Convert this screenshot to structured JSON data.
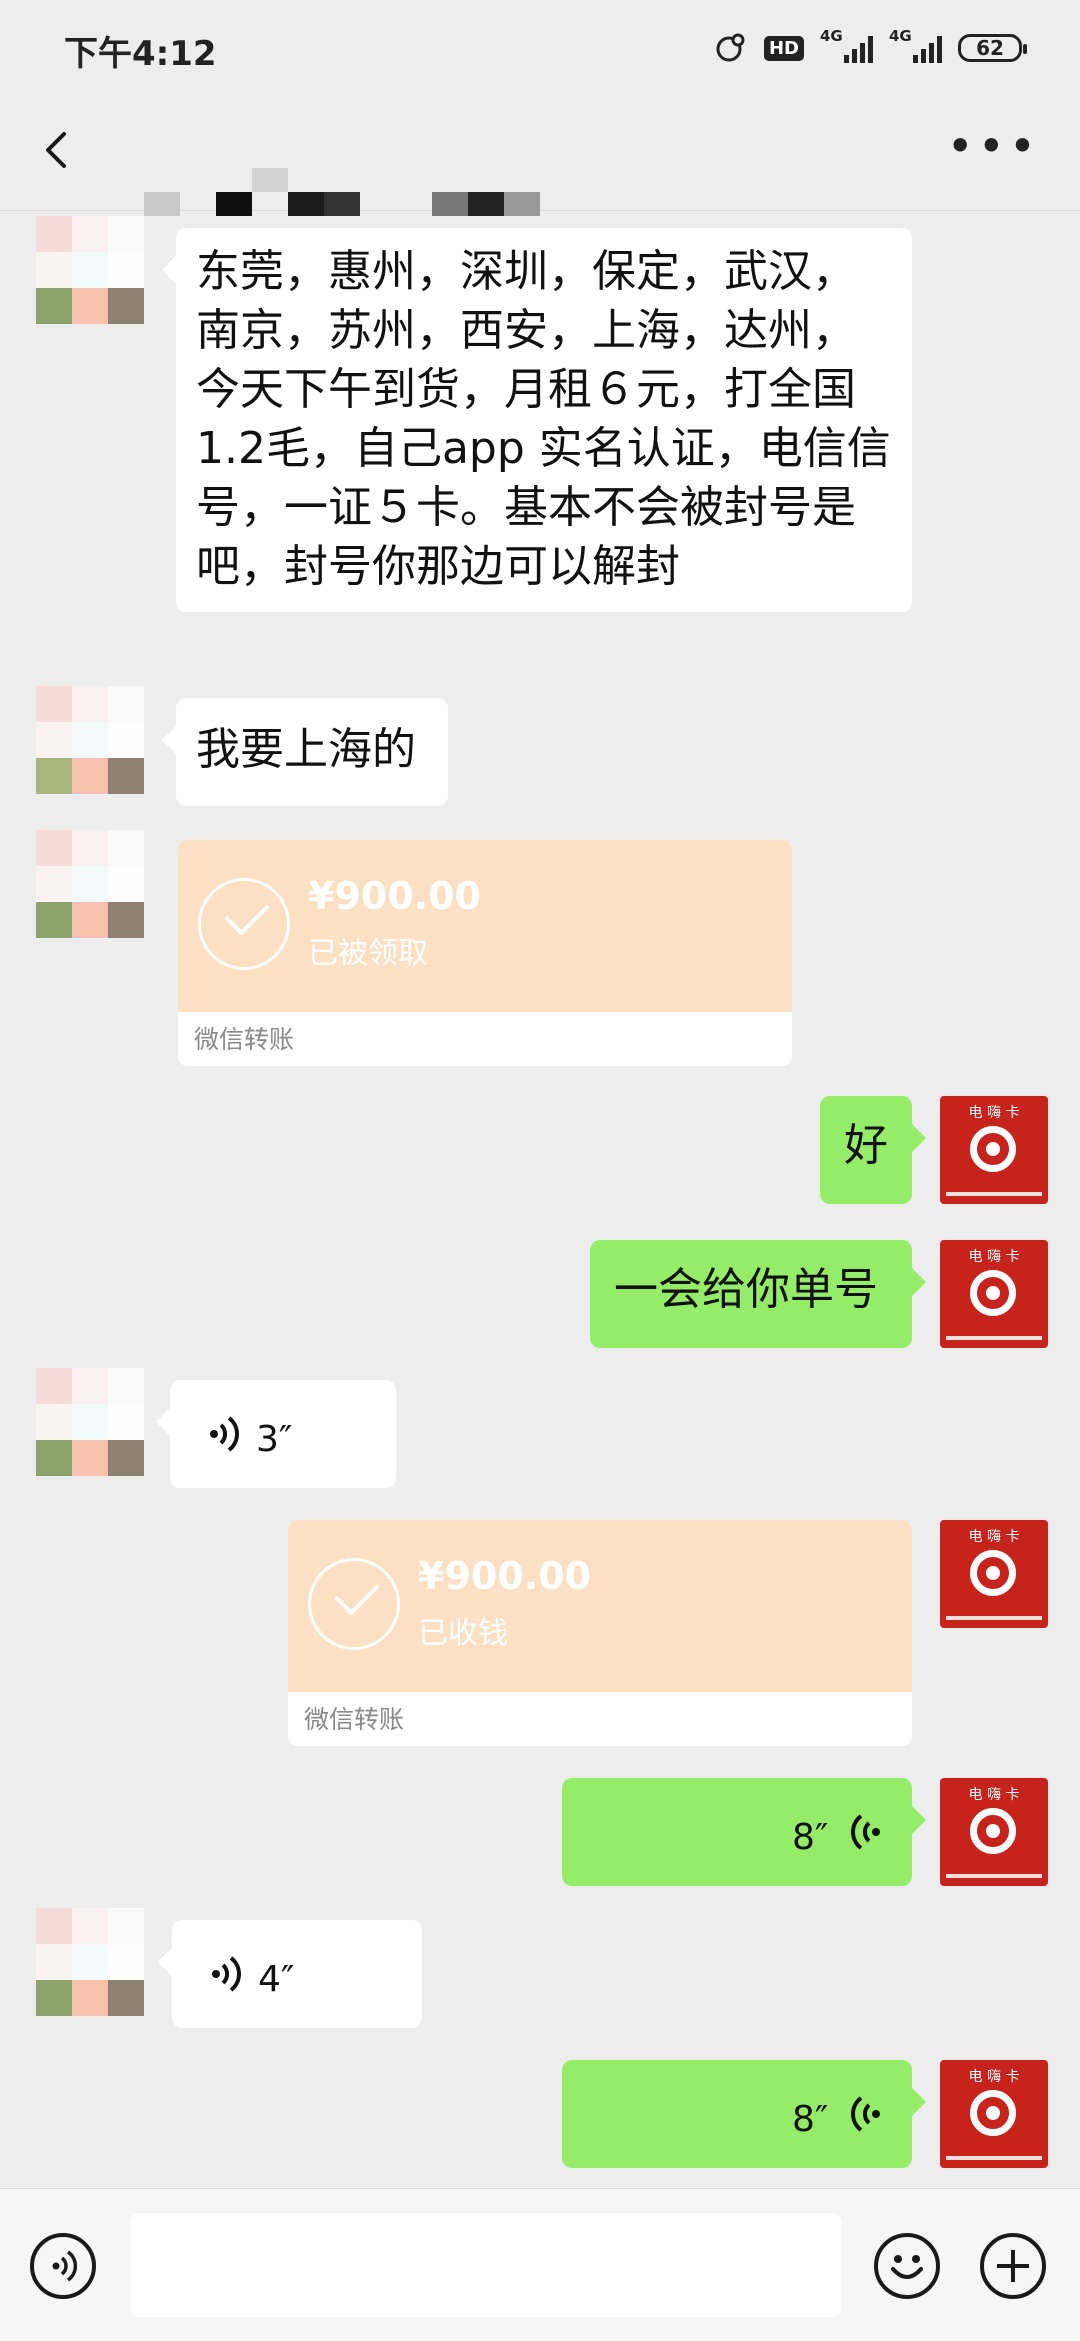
{
  "status_bar": {
    "time": "下午4:12",
    "hd": "HD",
    "network_1": "4G",
    "network_2": "4G",
    "battery": "62"
  },
  "header": {
    "back_icon": "back-arrow-icon",
    "more_icon": "more-icon",
    "contact_name_obscured": true
  },
  "messages": [
    {
      "side": "left",
      "type": "text",
      "text": "东莞，惠州，深圳，保定，武汉，南京，苏州，西安，上海，达州，今天下午到货，月租６元，打全国1.2毛，自己app 实名认证，电信信号，一证５卡。基本不会被封号是吧，封号你那边可以解封"
    },
    {
      "side": "left",
      "type": "text",
      "text": "我要上海的"
    },
    {
      "side": "left",
      "type": "transfer",
      "amount": "¥900.00",
      "status": "已被领取",
      "source": "微信转账"
    },
    {
      "side": "right",
      "type": "text",
      "text": "好"
    },
    {
      "side": "right",
      "type": "text",
      "text": "一会给你单号"
    },
    {
      "side": "left",
      "type": "voice",
      "duration": "3″"
    },
    {
      "side": "right",
      "type": "transfer",
      "amount": "¥900.00",
      "status": "已收钱",
      "source": "微信转账"
    },
    {
      "side": "right",
      "type": "voice",
      "duration": "8″"
    },
    {
      "side": "left",
      "type": "voice",
      "duration": "4″"
    },
    {
      "side": "right",
      "type": "voice",
      "duration": "8″"
    }
  ],
  "my_avatar": {
    "label": "电 嗨 卡"
  },
  "input_bar": {
    "voice_icon": "voice-mode-icon",
    "emoji_icon": "emoji-icon",
    "plus_icon": "plus-icon"
  }
}
